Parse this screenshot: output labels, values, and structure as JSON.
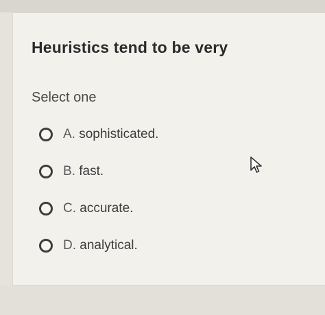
{
  "question": {
    "text": "Heuristics tend to be very"
  },
  "prompt": "Select one",
  "options": [
    {
      "letter": "A.",
      "label": "sophisticated."
    },
    {
      "letter": "B.",
      "label": "fast."
    },
    {
      "letter": "C.",
      "label": "accurate."
    },
    {
      "letter": "D.",
      "label": "analytical."
    }
  ],
  "icons": {
    "pointer": "mouse-pointer-icon",
    "radio": "radio-unselected-icon"
  },
  "colors": {
    "card_background": "#f3f1ec",
    "page_background": "#e6e2dc",
    "text": "#2b2b2b"
  }
}
